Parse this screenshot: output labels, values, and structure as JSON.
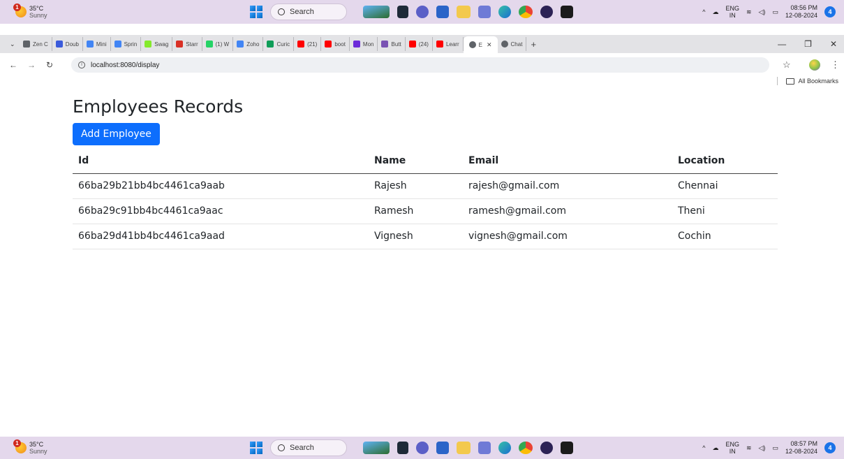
{
  "taskbar_top": {
    "weather_temp": "35°C",
    "weather_cond": "Sunny",
    "weather_badge": "1",
    "search_label": "Search",
    "lang_line1": "ENG",
    "lang_line2": "IN",
    "time": "08:56 PM",
    "date": "12-08-2024",
    "notif_count": "4"
  },
  "taskbar_bottom": {
    "weather_temp": "35°C",
    "weather_cond": "Sunny",
    "weather_badge": "1",
    "search_label": "Search",
    "lang_line1": "ENG",
    "lang_line2": "IN",
    "time": "08:57 PM",
    "date": "12-08-2024",
    "notif_count": "4"
  },
  "tabs": [
    {
      "label": "Zen C",
      "color": "#5f6368"
    },
    {
      "label": "Doub",
      "color": "#3b5bdb"
    },
    {
      "label": "Mini",
      "color": "#4285f4"
    },
    {
      "label": "Sprin",
      "color": "#4285f4"
    },
    {
      "label": "Swag",
      "color": "#85ea2d"
    },
    {
      "label": "Starr",
      "color": "#d93025"
    },
    {
      "label": "(1) W",
      "color": "#25d366"
    },
    {
      "label": "Zoho",
      "color": "#4285f4"
    },
    {
      "label": "Curic",
      "color": "#0f9d58"
    },
    {
      "label": "(21)",
      "color": "#ff0000"
    },
    {
      "label": "boot",
      "color": "#ff0000"
    },
    {
      "label": "Mon",
      "color": "#6c2bd9"
    },
    {
      "label": "Butt",
      "color": "#7952b3"
    },
    {
      "label": "(24)",
      "color": "#ff0000"
    },
    {
      "label": "Learr",
      "color": "#ff0000"
    }
  ],
  "active_tab": {
    "label": "E",
    "color": "#5f6368"
  },
  "after_tab": {
    "label": "Chat",
    "color": "#5f6368"
  },
  "address": {
    "url": "localhost:8080/display"
  },
  "bookmarks_label": "All Bookmarks",
  "page": {
    "title": "Employees Records",
    "add_button": "Add Employee"
  },
  "table": {
    "headers": [
      "Id",
      "Name",
      "Email",
      "Location"
    ],
    "rows": [
      [
        "66ba29b21bb4bc4461ca9aab",
        "Rajesh",
        "rajesh@gmail.com",
        "Chennai"
      ],
      [
        "66ba29c91bb4bc4461ca9aac",
        "Ramesh",
        "ramesh@gmail.com",
        "Theni"
      ],
      [
        "66ba29d41bb4bc4461ca9aad",
        "Vignesh",
        "vignesh@gmail.com",
        "Cochin"
      ]
    ]
  },
  "taskbar_app_icons": [
    "landscape-icon",
    "notes-icon",
    "chat-icon",
    "store-icon",
    "folder-icon",
    "tool-icon",
    "edge-icon",
    "chrome-icon",
    "eclipse-icon",
    "terminal-icon"
  ]
}
